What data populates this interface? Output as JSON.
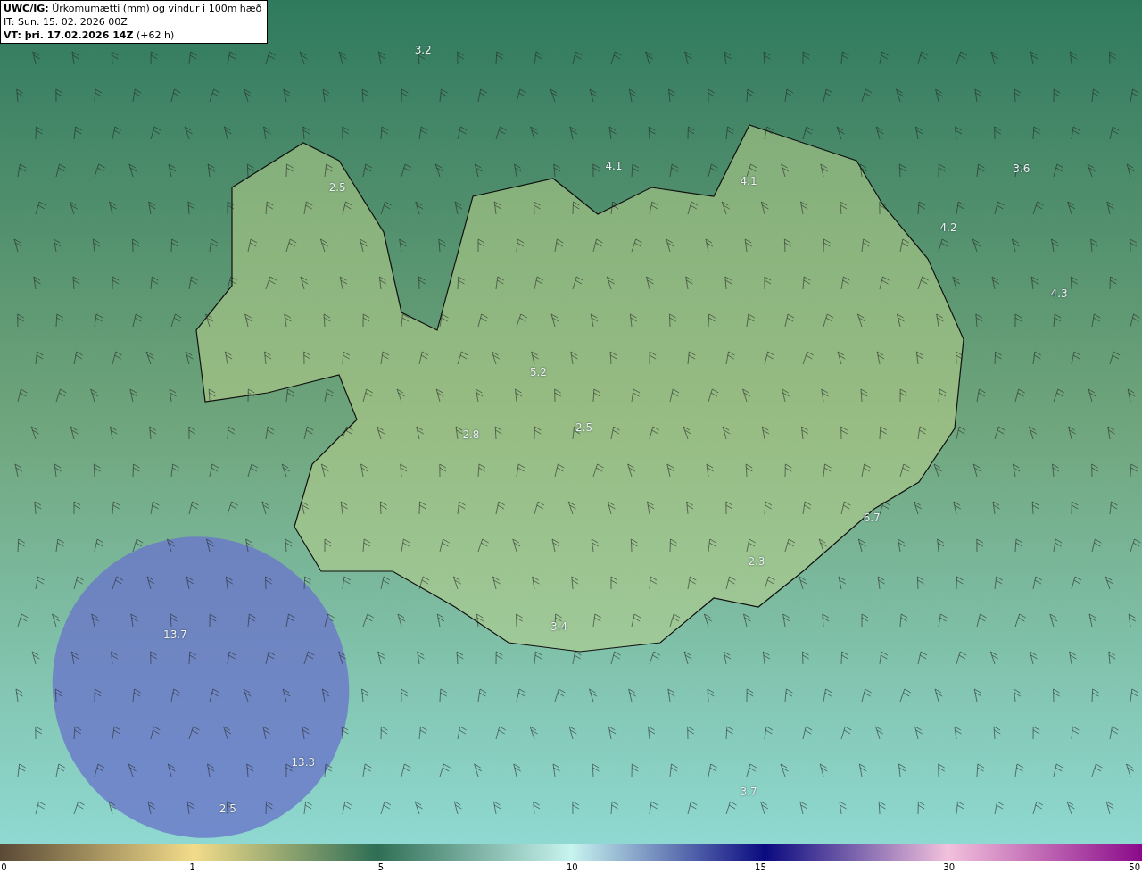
{
  "header": {
    "model": "UWC/IG:",
    "title": "Úrkomumætti (mm) og vindur i 100m hæð",
    "init_time": "IT: Sun. 15. 02. 2026 00Z",
    "valid_label": "VT: þri. 17.02.2026 14Z",
    "valid_offset": "(+62 h)"
  },
  "map_values": [
    {
      "text": "3.2"
    },
    {
      "text": "4.1"
    },
    {
      "text": "4.1"
    },
    {
      "text": "3.6"
    },
    {
      "text": "2.5"
    },
    {
      "text": "4.2"
    },
    {
      "text": "4.3"
    },
    {
      "text": "5.2"
    },
    {
      "text": "2.8"
    },
    {
      "text": "2.5"
    },
    {
      "text": "6.7"
    },
    {
      "text": "2.3"
    },
    {
      "text": "3.4"
    },
    {
      "text": "13.7"
    },
    {
      "text": "13.3"
    },
    {
      "text": "3.7"
    },
    {
      "text": "2.5"
    }
  ],
  "colorbar": {
    "labels": [
      "0",
      "1",
      "5",
      "10",
      "15",
      "30",
      "50"
    ]
  }
}
